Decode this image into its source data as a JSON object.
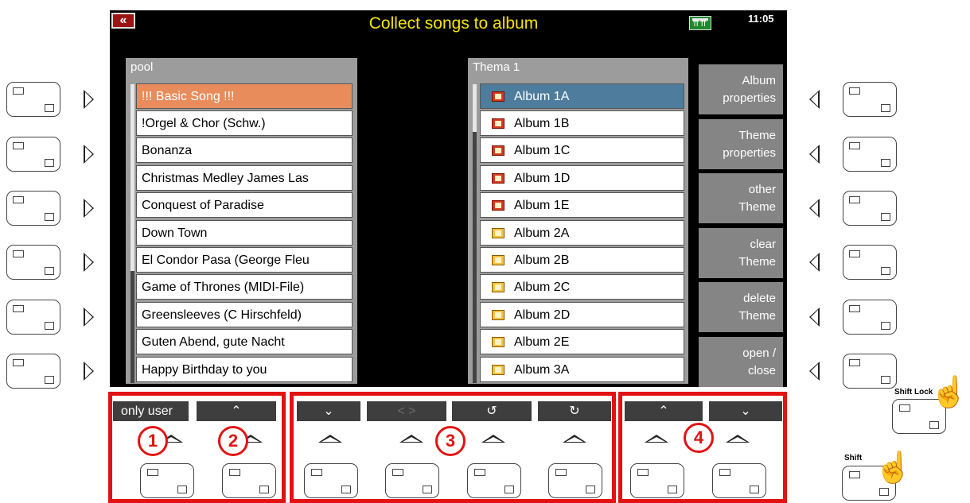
{
  "header": {
    "back_glyph": "«",
    "title": "Collect songs to album",
    "clock": "11:05",
    "registration_icon": "registration-memory-icon"
  },
  "pool": {
    "title": "pool",
    "items": [
      "!!! Basic Song !!!",
      "!Orgel & Chor (Schw.)",
      "Bonanza",
      "Christmas Medley James Las",
      "Conquest of Paradise",
      "Down Town",
      "El Condor Pasa (George Fleu",
      "Game of Thrones (MIDI-File)",
      "Greensleeves (C Hirschfeld)",
      "Guten Abend, gute Nacht",
      "Happy Birthday to you"
    ],
    "selected_index": 0
  },
  "thema": {
    "title": "Thema 1",
    "items": [
      "Album 1A",
      "Album 1B",
      "Album 1C",
      "Album 1D",
      "Album 1E",
      "Album 2A",
      "Album 2B",
      "Album 2C",
      "Album 2D",
      "Album 2E",
      "Album 3A"
    ],
    "selected_index": 0
  },
  "side_buttons": [
    {
      "line1": "Album",
      "line2": "properties"
    },
    {
      "line1": "Theme",
      "line2": "properties"
    },
    {
      "line1": "other",
      "line2": "Theme"
    },
    {
      "line1": "clear",
      "line2": "Theme"
    },
    {
      "line1": "delete",
      "line2": "Theme"
    },
    {
      "line1": "open  /",
      "line2": "close"
    }
  ],
  "soft_labels": [
    "only user",
    "⌃",
    "⌄",
    "< >",
    "↺",
    "↻",
    "⌃",
    "⌄"
  ],
  "badges": [
    "1",
    "2",
    "3",
    "4"
  ],
  "shift": {
    "shift_lock_label": "Shift Lock",
    "shift_label": "Shift"
  },
  "colors": {
    "title": "#f5e400",
    "pool_selected": "#e98c5c",
    "thema_selected": "#4d7c9c",
    "side_button": "#858585",
    "highlight_box": "#e31212"
  }
}
